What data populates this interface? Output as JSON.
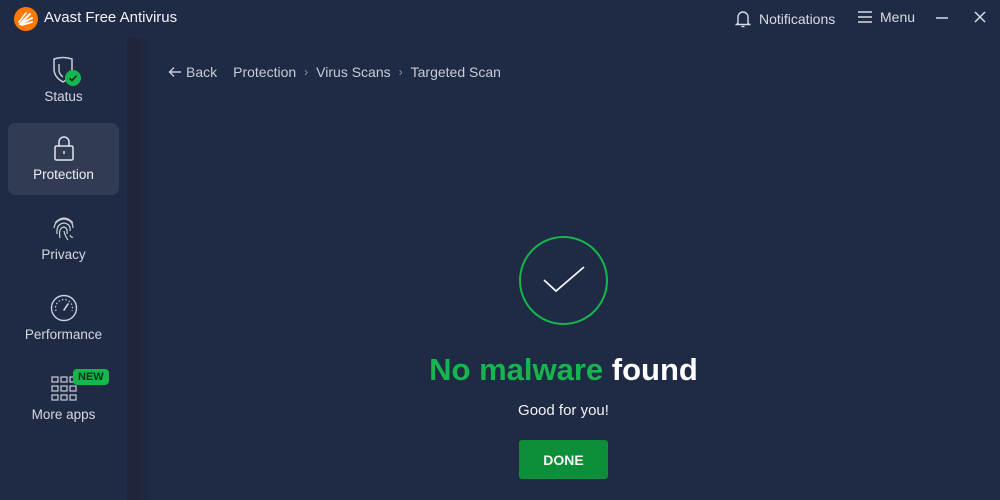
{
  "titlebar": {
    "app_title": "Avast Free Antivirus",
    "notifications_label": "Notifications",
    "menu_label": "Menu",
    "brand_color": "#ff7800"
  },
  "sidebar": {
    "items": [
      {
        "label": "Status",
        "icon": "shield-check-icon",
        "active": false
      },
      {
        "label": "Protection",
        "icon": "lock-icon",
        "active": true
      },
      {
        "label": "Privacy",
        "icon": "fingerprint-icon",
        "active": false
      },
      {
        "label": "Performance",
        "icon": "speedometer-icon",
        "active": false
      },
      {
        "label": "More apps",
        "icon": "grid-icon",
        "active": false,
        "badge": "NEW"
      }
    ]
  },
  "breadcrumb": {
    "back_label": "Back",
    "items": [
      "Protection",
      "Virus Scans",
      "Targeted Scan"
    ]
  },
  "result": {
    "headline_green": "No malware",
    "headline_white": "found",
    "subtitle": "Good for you!",
    "done_label": "DONE",
    "accent_color": "#16b54e"
  }
}
